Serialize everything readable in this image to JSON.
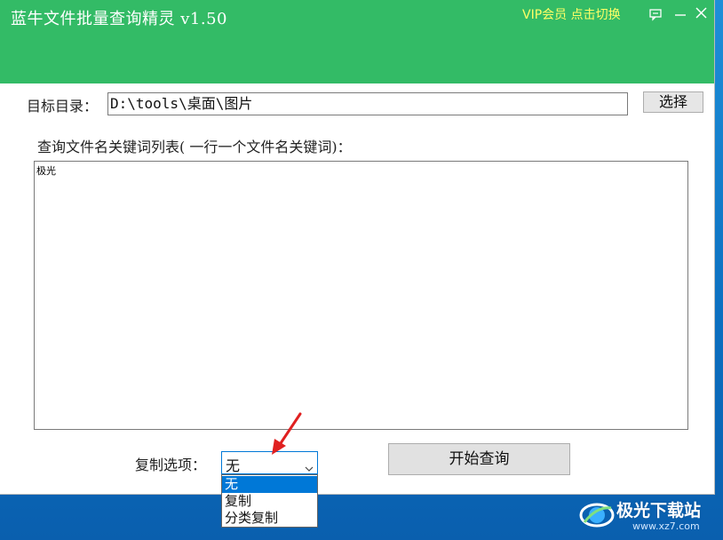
{
  "window": {
    "title": "蓝牛文件批量查询精灵  v1.50",
    "vip_link": "VIP会员 点击切换"
  },
  "form": {
    "target_dir_label": "目标目录：",
    "target_dir_value": "D:\\tools\\桌面\\图片",
    "choose_button": "选择",
    "keywords_label": "查询文件名关键词列表( 一行一个文件名关键词)：",
    "keywords_value": "极光",
    "copy_option_label": "复制选项：",
    "copy_option_selected": "无",
    "copy_options": [
      "无",
      "复制",
      "分类复制"
    ],
    "start_button": "开始查询"
  },
  "watermark": {
    "text": "极光下载站",
    "sub": "www.xz7.com"
  },
  "colors": {
    "titlebar": "#33bb66",
    "vip_text": "#ffff66",
    "selection": "#0078d7",
    "arrow": "#e02020"
  }
}
